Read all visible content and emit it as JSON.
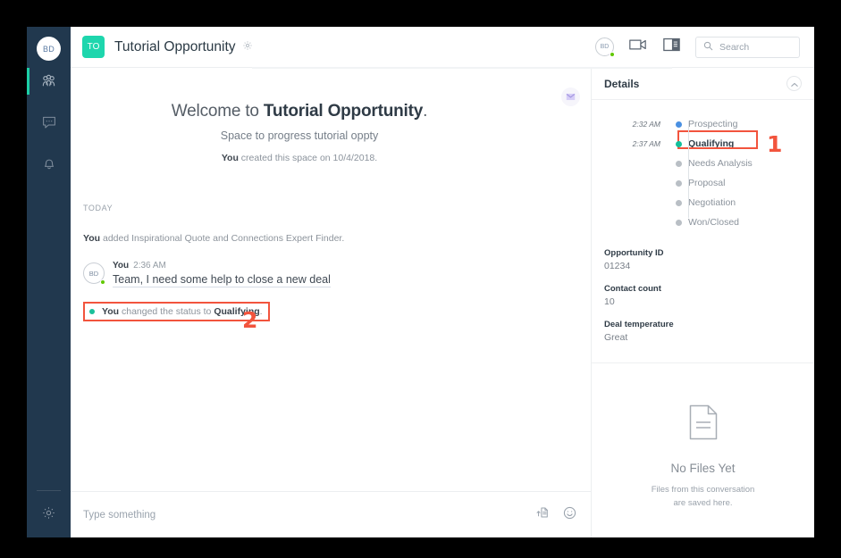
{
  "left_rail": {
    "avatar_initials": "BD",
    "items": [
      {
        "name": "teams",
        "icon": "people-icon",
        "active": true
      },
      {
        "name": "messaging",
        "icon": "chat-bubble-icon",
        "active": false
      },
      {
        "name": "notifications",
        "icon": "bell-icon",
        "active": false
      }
    ],
    "settings_icon": "gear-icon"
  },
  "header": {
    "space_badge": "TO",
    "space_title": "Tutorial Opportunity",
    "settings_icon": "gear-icon",
    "avatar_initials": "BD",
    "video_icon": "video-camera-icon",
    "layout_icon": "panel-layout-icon",
    "search_placeholder": "Search",
    "search_value": ""
  },
  "conversation": {
    "welcome_prefix": "Welcome to ",
    "welcome_space": "Tutorial Opportunity",
    "welcome_suffix": ".",
    "welcome_subtitle": "Space to progress tutorial oppty",
    "created_by": "You",
    "created_text": " created this space on 10/4/2018.",
    "day_divider": "TODAY",
    "system_activity": {
      "prefix": "You",
      "text": " added Inspirational Quote and Connections Expert Finder."
    },
    "message": {
      "author": "You",
      "time": "2:36 AM",
      "avatar_initials": "BD",
      "text": "Team, I need some help to close a new deal"
    },
    "status_change": {
      "author": "You",
      "text_mid": " changed the status to ",
      "status": "Qualifying",
      "text_end": ".",
      "dot_color": "#1ac09a"
    },
    "composer_placeholder": "Type something",
    "composer_value": "",
    "attach_icon": "attach-file-icon",
    "emoji_icon": "emoji-smiley-icon",
    "mail_icon": "mail-icon"
  },
  "details": {
    "title": "Details",
    "collapse_icon": "chevron-up-icon",
    "statuses": [
      {
        "time": "2:32 AM",
        "label": "Prospecting",
        "dot": "blue",
        "active": false
      },
      {
        "time": "2:37 AM",
        "label": "Qualifying",
        "dot": "green",
        "active": true
      },
      {
        "time": "",
        "label": "Needs Analysis",
        "dot": "gray",
        "active": false
      },
      {
        "time": "",
        "label": "Proposal",
        "dot": "gray",
        "active": false
      },
      {
        "time": "",
        "label": "Negotiation",
        "dot": "gray",
        "active": false
      },
      {
        "time": "",
        "label": "Won/Closed",
        "dot": "gray",
        "active": false
      }
    ],
    "fields": [
      {
        "label": "Opportunity ID",
        "value": "01234"
      },
      {
        "label": "Contact count",
        "value": "10"
      },
      {
        "label": "Deal temperature",
        "value": "Great"
      }
    ],
    "no_files": {
      "icon": "document-file-icon",
      "title": "No Files Yet",
      "line1": "Files from this conversation",
      "line2": "are saved here."
    }
  },
  "annotations": {
    "callout_1": "1",
    "callout_2": "2",
    "highlight_color": "#f2543d"
  },
  "colors": {
    "rail_bg": "#21384e",
    "active_indicator": "#1ccfa6",
    "space_badge_bg": "#1ed6ad",
    "status_blue": "#4a90e2",
    "status_green": "#14bf9b",
    "presence_green": "#61c800"
  }
}
